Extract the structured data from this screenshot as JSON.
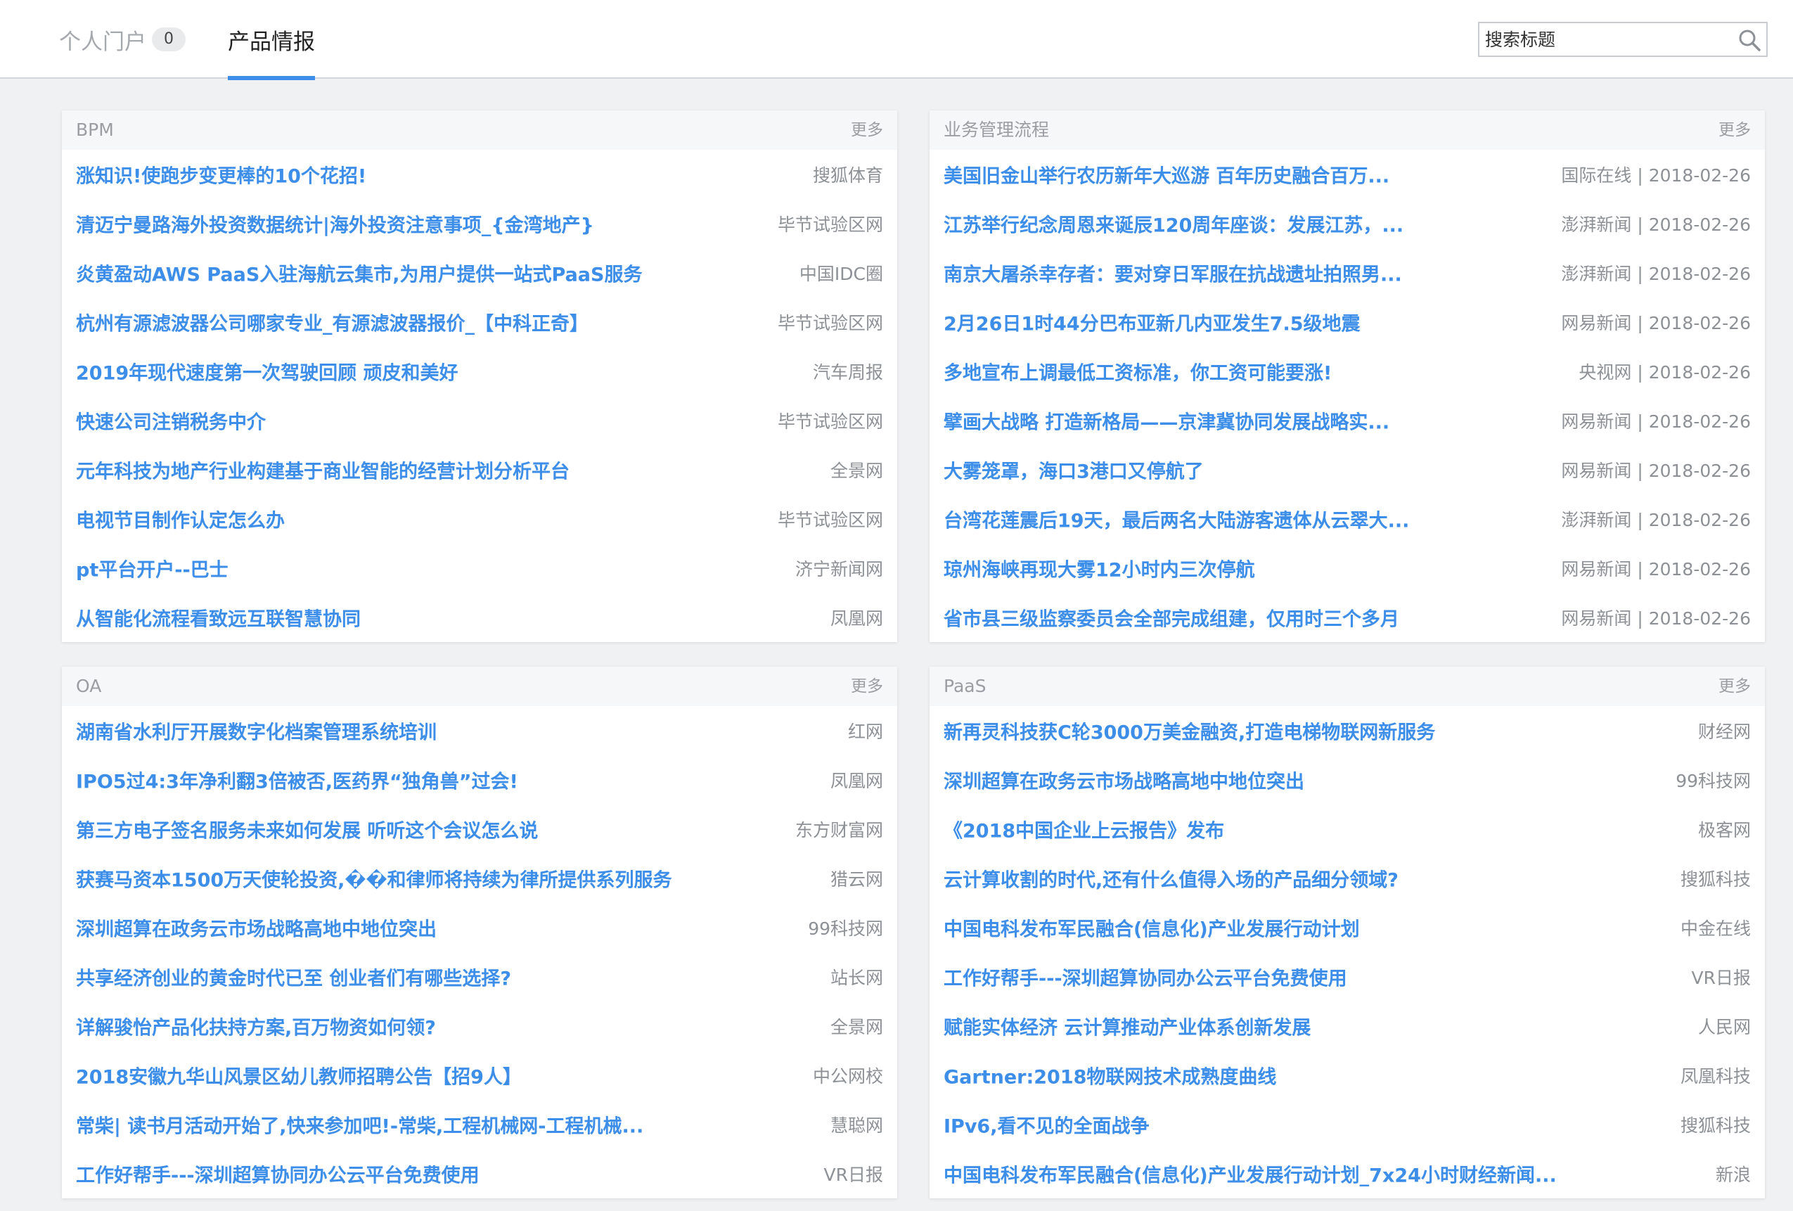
{
  "tabs": {
    "portal_label": "个人门户",
    "portal_count": "0",
    "intel_label": "产品情报"
  },
  "search": {
    "placeholder": "搜索标题"
  },
  "panels": [
    {
      "title": "BPM",
      "more": "更多",
      "items": [
        {
          "title": "涨知识!使跑步变更棒的10个花招!",
          "meta": "搜狐体育"
        },
        {
          "title": "清迈宁曼路海外投资数据统计|海外投资注意事项_{金湾地产}",
          "meta": "毕节试验区网"
        },
        {
          "title": "炎黄盈动AWS PaaS入驻海航云集市,为用户提供一站式PaaS服务",
          "meta": "中国IDC圈"
        },
        {
          "title": "杭州有源滤波器公司哪家专业_有源滤波器报价_【中科正奇】",
          "meta": "毕节试验区网"
        },
        {
          "title": "2019年现代速度第一次驾驶回顾 顽皮和美好",
          "meta": "汽车周报"
        },
        {
          "title": "快速公司注销税务中介",
          "meta": "毕节试验区网"
        },
        {
          "title": "元年科技为地产行业构建基于商业智能的经营计划分析平台",
          "meta": "全景网"
        },
        {
          "title": "电视节目制作认定怎么办",
          "meta": "毕节试验区网"
        },
        {
          "title": "pt平台开户--巴士",
          "meta": "济宁新闻网"
        },
        {
          "title": "从智能化流程看致远互联智慧协同",
          "meta": "凤凰网"
        }
      ]
    },
    {
      "title": "业务管理流程",
      "more": "更多",
      "items": [
        {
          "title": "美国旧金山举行农历新年大巡游 百年历史融合百万...",
          "meta": "国际在线 | 2018-02-26"
        },
        {
          "title": "江苏举行纪念周恩来诞辰120周年座谈：发展江苏，...",
          "meta": "澎湃新闻 | 2018-02-26"
        },
        {
          "title": "南京大屠杀幸存者：要对穿日军服在抗战遗址拍照男...",
          "meta": "澎湃新闻 | 2018-02-26"
        },
        {
          "title": "2月26日1时44分巴布亚新几内亚发生7.5级地震",
          "meta": "网易新闻 | 2018-02-26"
        },
        {
          "title": "多地宣布上调最低工资标准，你工资可能要涨!",
          "meta": "央视网 | 2018-02-26"
        },
        {
          "title": "擘画大战略 打造新格局——京津冀协同发展战略实...",
          "meta": "网易新闻 | 2018-02-26"
        },
        {
          "title": "大雾笼罩，海口3港口又停航了",
          "meta": "网易新闻 | 2018-02-26"
        },
        {
          "title": "台湾花莲震后19天，最后两名大陆游客遗体从云翠大...",
          "meta": "澎湃新闻 | 2018-02-26"
        },
        {
          "title": "琼州海峡再现大雾12小时内三次停航",
          "meta": "网易新闻 | 2018-02-26"
        },
        {
          "title": "省市县三级监察委员会全部完成组建，仅用时三个多月",
          "meta": "网易新闻 | 2018-02-26"
        }
      ]
    },
    {
      "title": "OA",
      "more": "更多",
      "items": [
        {
          "title": "湖南省水利厅开展数字化档案管理系统培训",
          "meta": "红网"
        },
        {
          "title": "IPO5过4:3年净利翻3倍被否,医药界“独角兽”过会!",
          "meta": "凤凰网"
        },
        {
          "title": "第三方电子签名服务未来如何发展 听听这个会议怎么说",
          "meta": "东方财富网"
        },
        {
          "title": "获赛马资本1500万天使轮投资,��和律师将持续为律所提供系列服务",
          "meta": "猎云网"
        },
        {
          "title": "深圳超算在政务云市场战略高地中地位突出",
          "meta": "99科技网"
        },
        {
          "title": "共享经济创业的黄金时代已至 创业者们有哪些选择?",
          "meta": "站长网"
        },
        {
          "title": "详解骏怡产品化扶持方案,百万物资如何领?",
          "meta": "全景网"
        },
        {
          "title": "2018安徽九华山风景区幼儿教师招聘公告【招9人】",
          "meta": "中公网校"
        },
        {
          "title": "常柴| 读书月活动开始了,快来参加吧!-常柴,工程机械网-工程机械...",
          "meta": "慧聪网"
        },
        {
          "title": "工作好帮手---深圳超算协同办公云平台免费使用",
          "meta": "VR日报"
        }
      ]
    },
    {
      "title": "PaaS",
      "more": "更多",
      "items": [
        {
          "title": "新再灵科技获C轮3000万美金融资,打造电梯物联网新服务",
          "meta": "财经网"
        },
        {
          "title": "深圳超算在政务云市场战略高地中地位突出",
          "meta": "99科技网"
        },
        {
          "title": "《2018中国企业上云报告》发布",
          "meta": "极客网"
        },
        {
          "title": "云计算收割的时代,还有什么值得入场的产品细分领域?",
          "meta": "搜狐科技"
        },
        {
          "title": "中国电科发布军民融合(信息化)产业发展行动计划",
          "meta": "中金在线"
        },
        {
          "title": "工作好帮手---深圳超算协同办公云平台免费使用",
          "meta": "VR日报"
        },
        {
          "title": "赋能实体经济 云计算推动产业体系创新发展",
          "meta": "人民网"
        },
        {
          "title": "Gartner:2018物联网技术成熟度曲线",
          "meta": "凤凰科技"
        },
        {
          "title": "IPv6,看不见的全面战争",
          "meta": "搜狐科技"
        },
        {
          "title": "中国电科发布军民融合(信息化)产业发展行动计划_7x24小时财经新闻...",
          "meta": "新浪"
        }
      ]
    }
  ]
}
